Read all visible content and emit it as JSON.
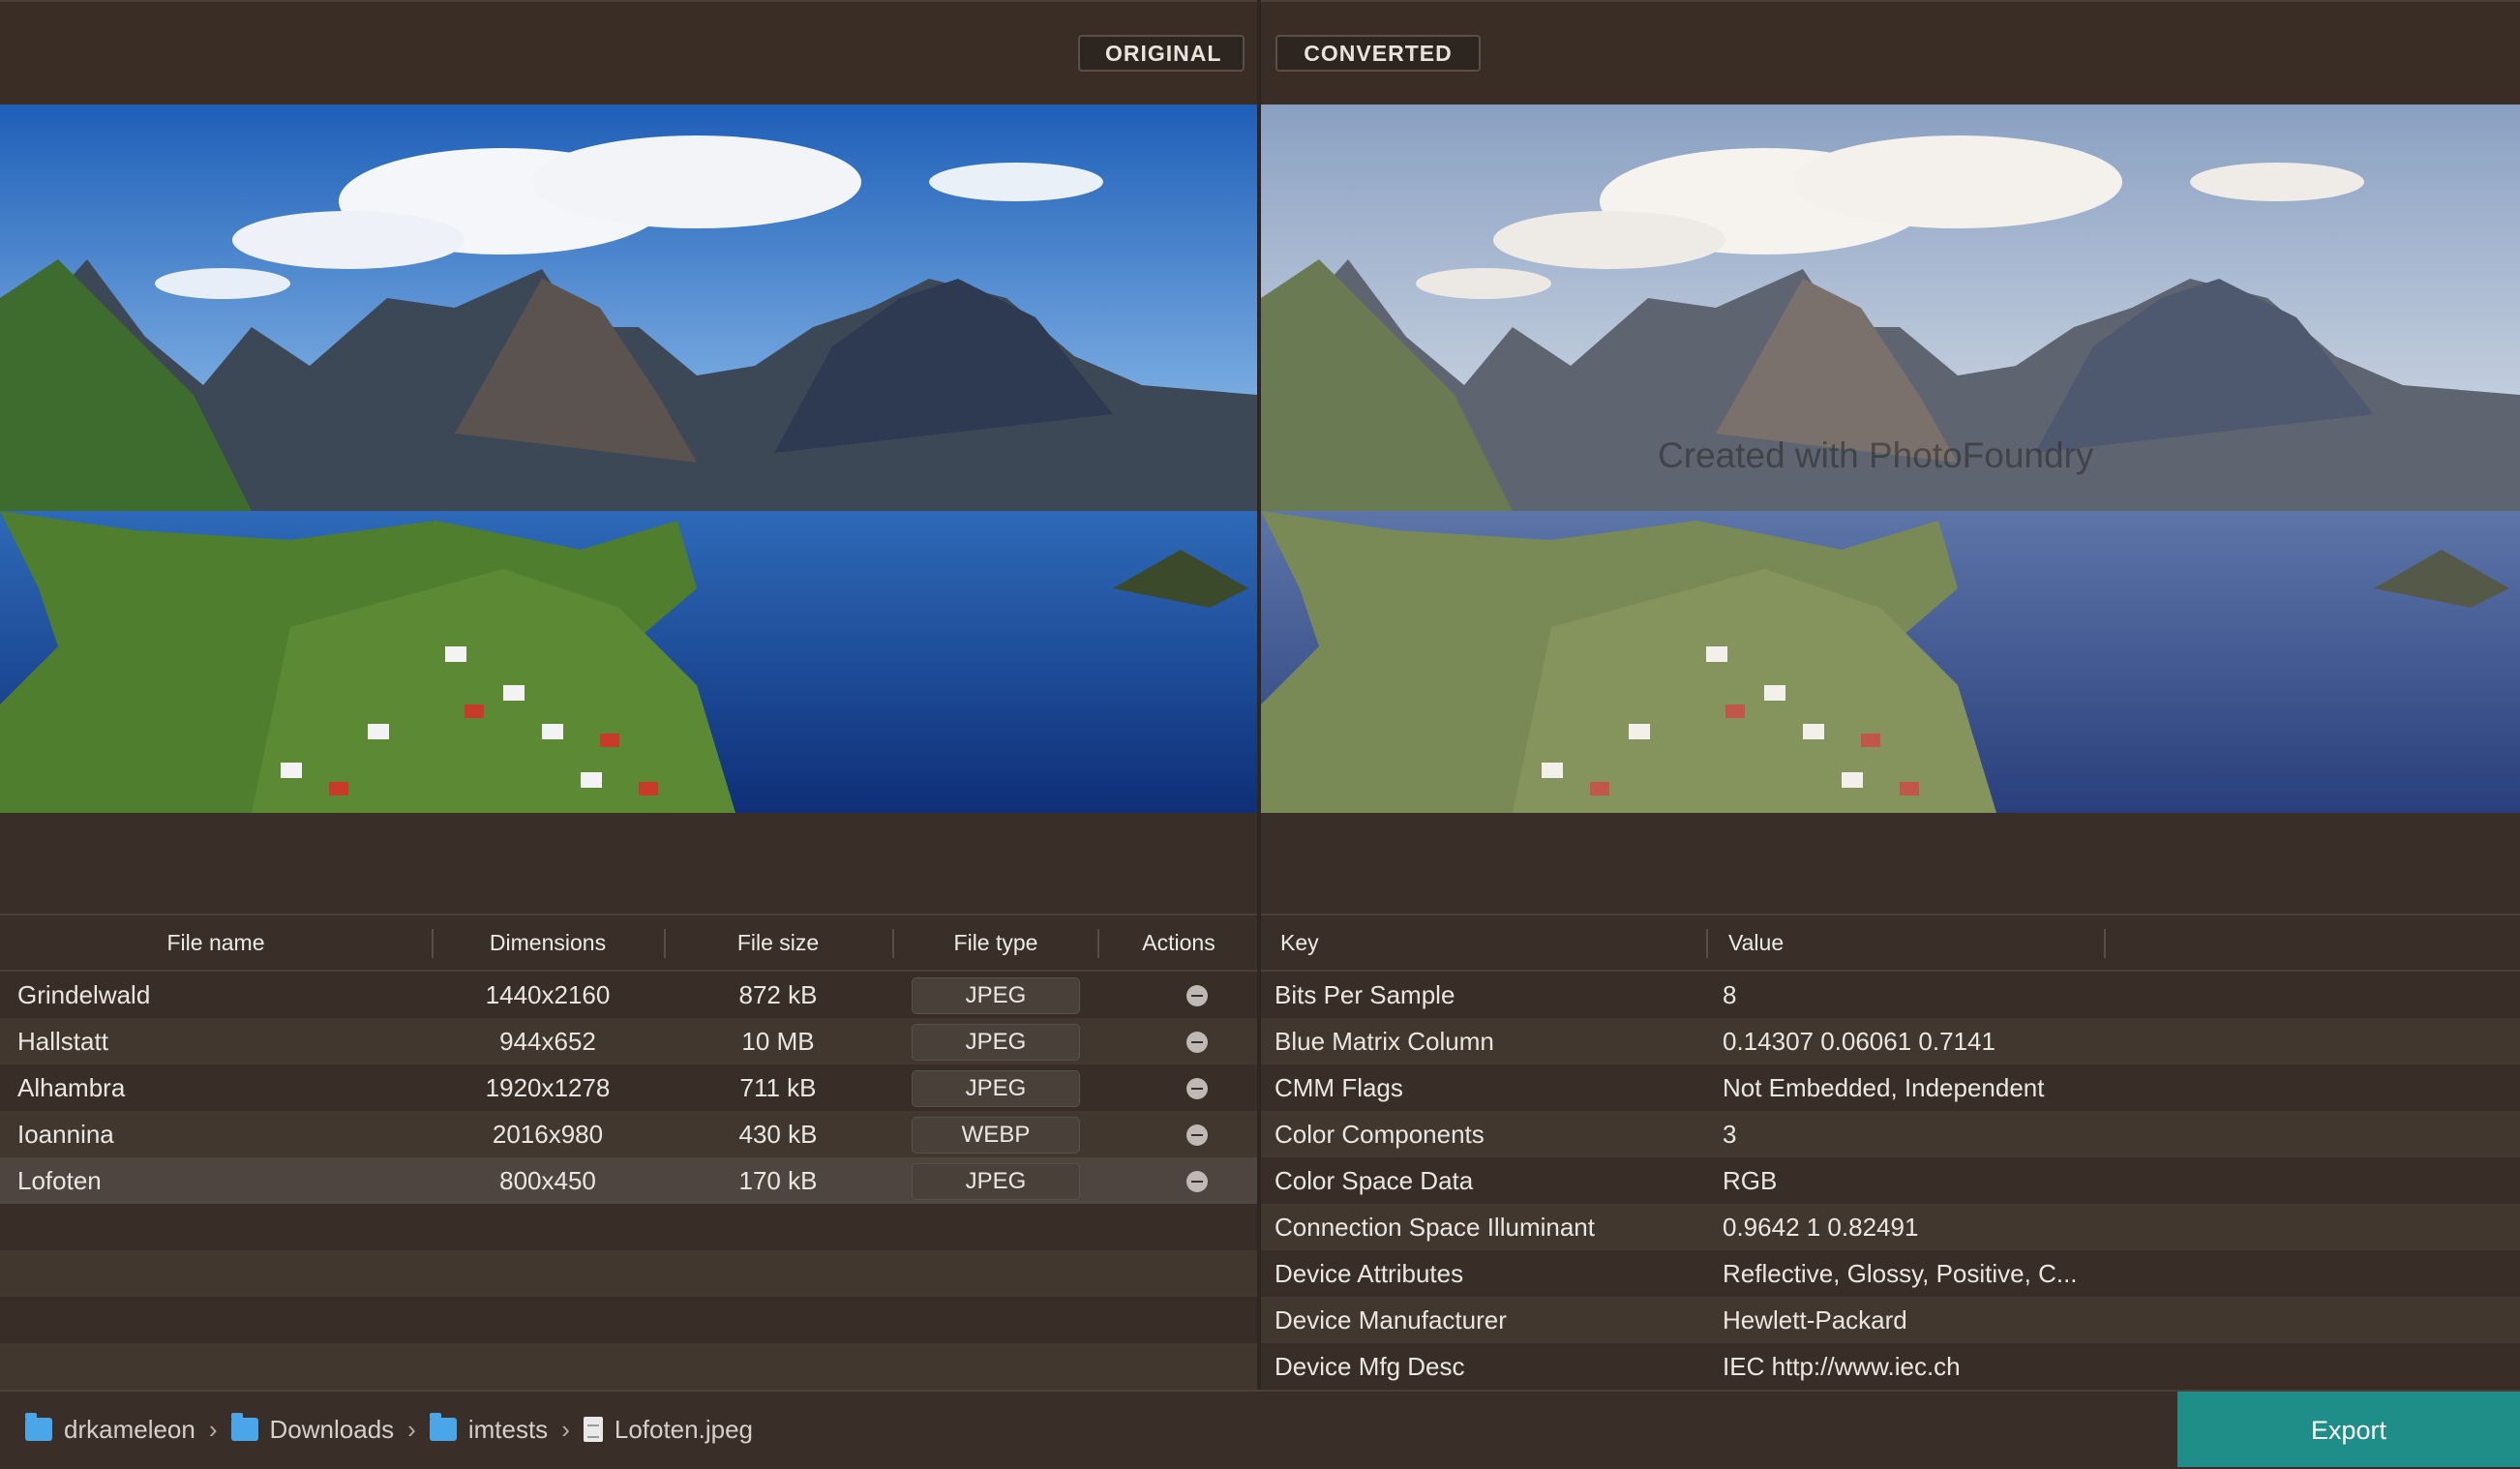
{
  "header": {
    "original_label": "ORIGINAL",
    "converted_label": "CONVERTED"
  },
  "converted": {
    "watermark": "Created with PhotoFoundry"
  },
  "files": {
    "columns": [
      "File name",
      "Dimensions",
      "File size",
      "File type",
      "Actions"
    ],
    "rows": [
      {
        "name": "Grindelwald",
        "dimensions": "1440x2160",
        "size": "872 kB",
        "type": "JPEG"
      },
      {
        "name": "Hallstatt",
        "dimensions": "944x652",
        "size": "10 MB",
        "type": "JPEG"
      },
      {
        "name": "Alhambra",
        "dimensions": "1920x1278",
        "size": "711 kB",
        "type": "JPEG"
      },
      {
        "name": "Ioannina",
        "dimensions": "2016x980",
        "size": "430 kB",
        "type": "WEBP"
      },
      {
        "name": "Lofoten",
        "dimensions": "800x450",
        "size": "170 kB",
        "type": "JPEG"
      }
    ],
    "selected_index": 4
  },
  "metadata": {
    "columns": [
      "Key",
      "Value"
    ],
    "rows": [
      {
        "key": "Bits Per Sample",
        "value": "8"
      },
      {
        "key": "Blue Matrix Column",
        "value": "0.14307 0.06061 0.7141"
      },
      {
        "key": "CMM Flags",
        "value": "Not Embedded, Independent"
      },
      {
        "key": "Color Components",
        "value": "3"
      },
      {
        "key": "Color Space Data",
        "value": "RGB"
      },
      {
        "key": "Connection Space Illuminant",
        "value": "0.9642 1 0.82491"
      },
      {
        "key": "Device Attributes",
        "value": "Reflective, Glossy, Positive, C..."
      },
      {
        "key": "Device Manufacturer",
        "value": "Hewlett-Packard"
      },
      {
        "key": "Device Mfg Desc",
        "value": "IEC http://www.iec.ch"
      }
    ]
  },
  "breadcrumb": [
    "drkameleon",
    "Downloads",
    "imtests",
    "Lofoten.jpeg"
  ],
  "export_label": "Export",
  "colors": {
    "accent": "#1f8e88",
    "background": "#3a2f28",
    "folder_icon": "#4aa6e8"
  }
}
